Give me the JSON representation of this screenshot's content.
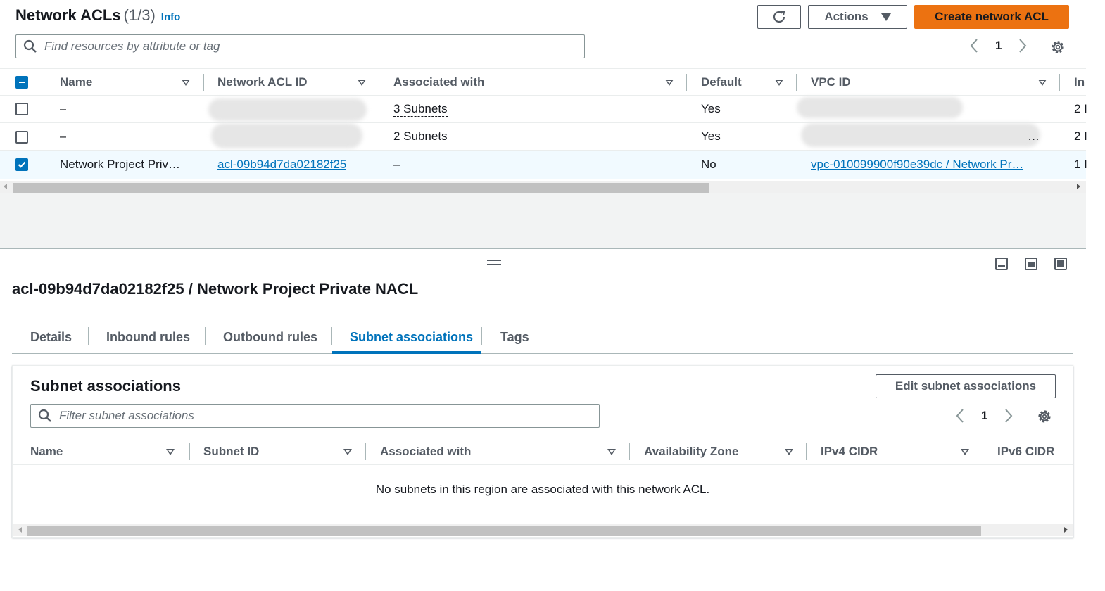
{
  "header": {
    "title": "Network ACLs",
    "count": "(1/3)",
    "info": "Info",
    "actions_label": "Actions",
    "create_label": "Create network ACL"
  },
  "search": {
    "placeholder": "Find resources by attribute or tag"
  },
  "pagination": {
    "page": "1"
  },
  "table": {
    "columns": [
      "Name",
      "Network ACL ID",
      "Associated with",
      "Default",
      "VPC ID",
      "In"
    ],
    "rows": [
      {
        "name": "–",
        "acl_id": "",
        "associated": "3 Subnets",
        "default": "Yes",
        "vpc": "",
        "inbound": "2 I",
        "selected": false
      },
      {
        "name": "–",
        "acl_id": "",
        "associated": "2 Subnets",
        "default": "Yes",
        "vpc": "…",
        "inbound": "2 I",
        "selected": false
      },
      {
        "name": "Network Project Priv…",
        "acl_id": "acl-09b94d7da02182f25",
        "associated": "–",
        "default": "No",
        "vpc": "vpc-010099900f90e39dc / Network Pr…",
        "inbound": "1 I",
        "selected": true
      }
    ]
  },
  "detail": {
    "title": "acl-09b94d7da02182f25 / Network Project Private NACL",
    "tabs": [
      "Details",
      "Inbound rules",
      "Outbound rules",
      "Subnet associations",
      "Tags"
    ],
    "active_tab": "Subnet associations",
    "section_title": "Subnet associations",
    "edit_label": "Edit subnet associations",
    "filter_placeholder": "Filter subnet associations",
    "page": "1",
    "columns": [
      "Name",
      "Subnet ID",
      "Associated with",
      "Availability Zone",
      "IPv4 CIDR",
      "IPv6 CIDR"
    ],
    "empty_message": "No subnets in this region are associated with this network ACL."
  },
  "colors": {
    "accent": "#0073bb",
    "primary_button": "#ec7211"
  },
  "icons": [
    "refresh-icon",
    "caret-down-icon",
    "search-icon",
    "chevron-left-icon",
    "chevron-right-icon",
    "gear-icon",
    "sort-icon",
    "checkbox-icon"
  ]
}
